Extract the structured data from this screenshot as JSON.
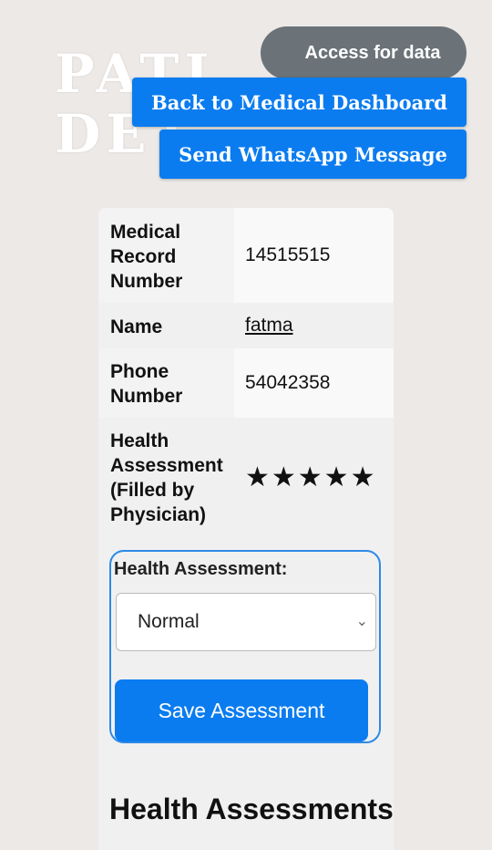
{
  "background_title": "PATI\nDET",
  "header": {
    "access_label": "Access for data",
    "back_label": "Back to Medical Dashboard",
    "whatsapp_label": "Send WhatsApp Message"
  },
  "details": [
    {
      "key": "Medical Record Number",
      "value": "14515515"
    },
    {
      "key": "Name",
      "value": "fatma"
    },
    {
      "key": "Phone Number",
      "value": "54042358"
    },
    {
      "key": "Health Assessment (Filled by Physician)",
      "value": "★★★★★"
    }
  ],
  "form": {
    "label": "Health Assessment:",
    "selected": "Normal",
    "save_label": "Save Assessment"
  },
  "section_title": "Health Assessments",
  "colors": {
    "primary": "#0a7cf0",
    "secondary": "#6b7378"
  }
}
